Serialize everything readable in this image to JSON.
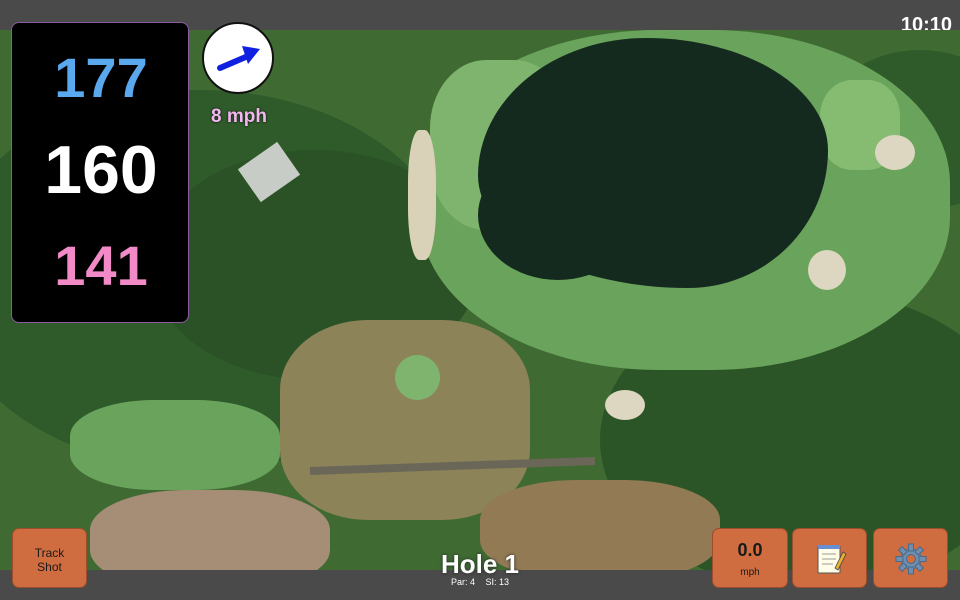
{
  "status": {
    "time": "10:10"
  },
  "distances": {
    "back": "177",
    "middle": "160",
    "front": "141"
  },
  "wind": {
    "speed": "8 mph",
    "icon": "wind-arrow-icon"
  },
  "hole": {
    "title": "Hole 1",
    "par": "Par: 4",
    "stroke_index": "SI: 13"
  },
  "buttons": {
    "track_shot": "Track\nShot",
    "speed_value": "0.0",
    "speed_unit": "mph",
    "notes_icon": "notepad-icon",
    "settings_icon": "gear-icon"
  },
  "colors": {
    "back_distance": "#5aa8ee",
    "middle_distance": "#ffffff",
    "front_distance": "#f28ac7",
    "button": "#cf6d40",
    "wind_arrow": "#1020e0"
  }
}
